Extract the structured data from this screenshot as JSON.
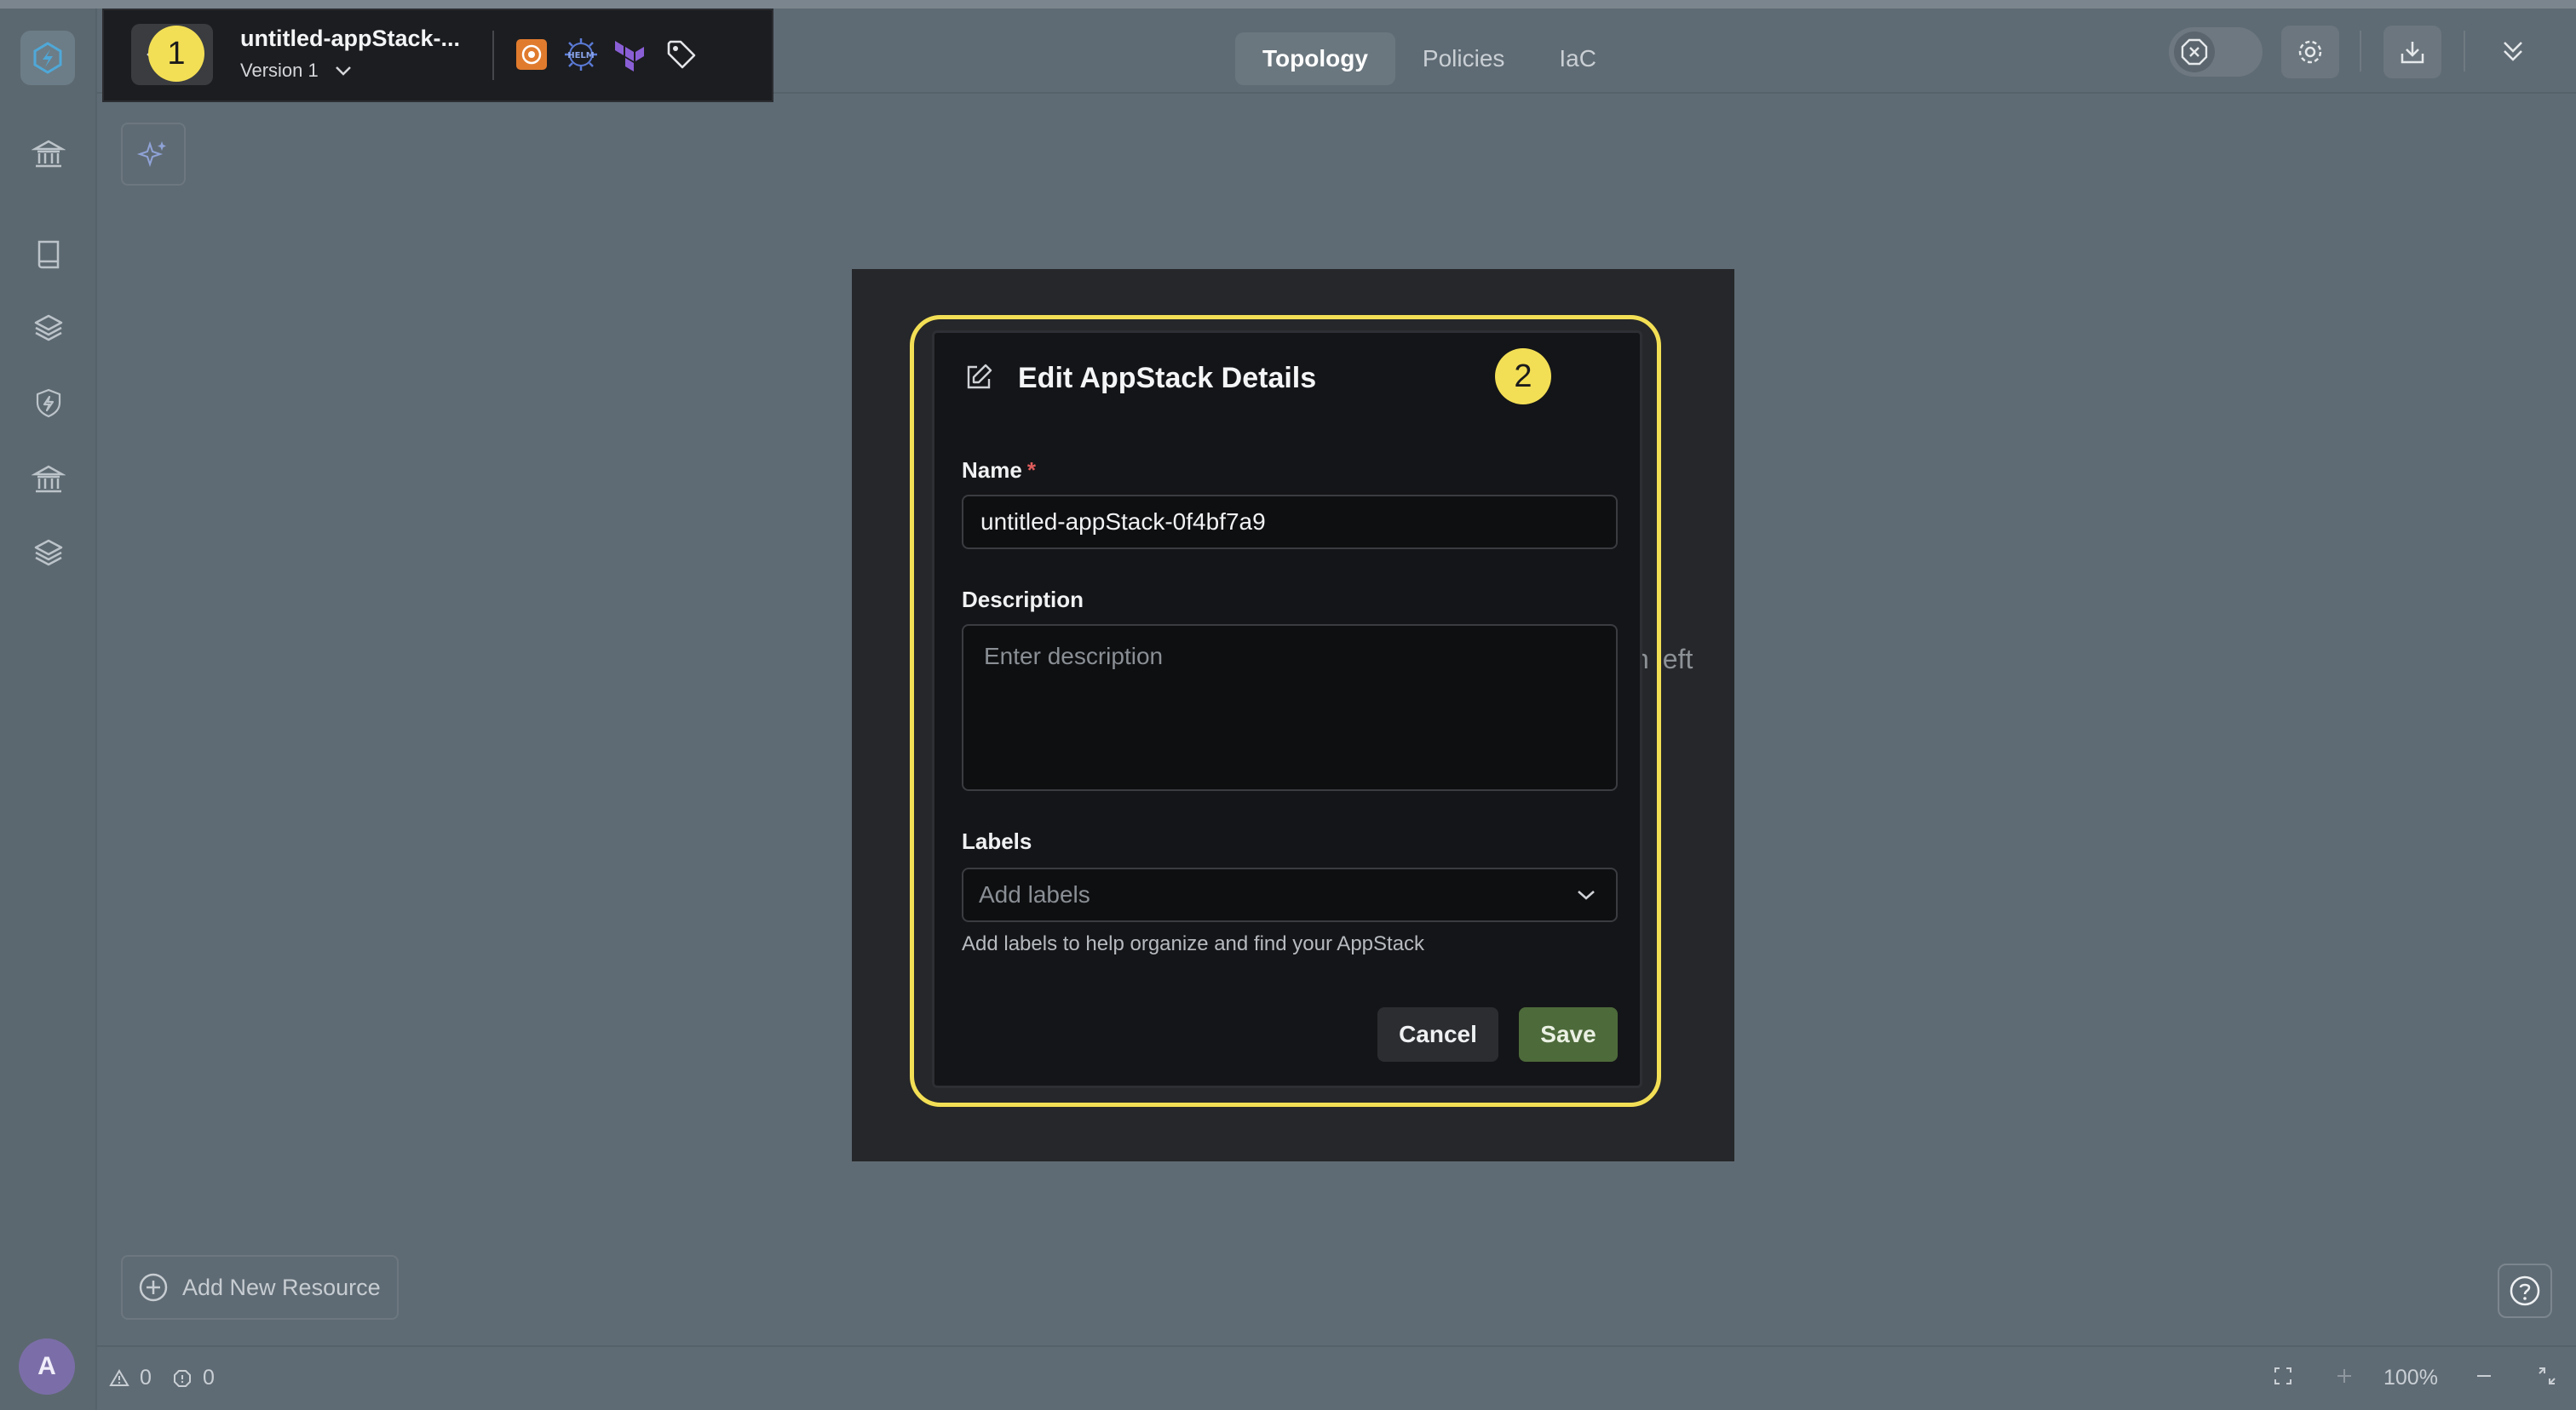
{
  "header": {
    "app_name": "untitled-appStack-...",
    "version": "Version 1",
    "tabs": [
      {
        "label": "Topology",
        "active": true
      },
      {
        "label": "Policies",
        "active": false
      },
      {
        "label": "IaC",
        "active": false
      }
    ],
    "tech_icons": [
      "aws-icon",
      "helm-icon",
      "terraform-icon",
      "tag-icon"
    ]
  },
  "badges": {
    "step1": "1",
    "step2": "2"
  },
  "sidebar": {
    "items": [
      "bank-icon",
      "book-icon",
      "layers-icon",
      "shield-icon",
      "bank-icon",
      "layers-icon"
    ],
    "avatar_initial": "A"
  },
  "canvas": {
    "add_resource_label": "Add New Resource",
    "backdrop_hint": "n left"
  },
  "modal": {
    "title": "Edit AppStack Details",
    "name_label": "Name",
    "required_mark": "*",
    "name_value": "untitled-appStack-0f4bf7a9",
    "description_label": "Description",
    "description_placeholder": "Enter description",
    "labels_label": "Labels",
    "labels_placeholder": "Add labels",
    "labels_help": "Add labels to help organize and find your AppStack",
    "cancel_label": "Cancel",
    "save_label": "Save"
  },
  "statusbar": {
    "warnings": "0",
    "info": "0",
    "zoom": "100%"
  },
  "colors": {
    "accent_yellow": "#f3df55",
    "save_green": "#4d6a3a",
    "canvas_bg": "#5f6b74"
  }
}
